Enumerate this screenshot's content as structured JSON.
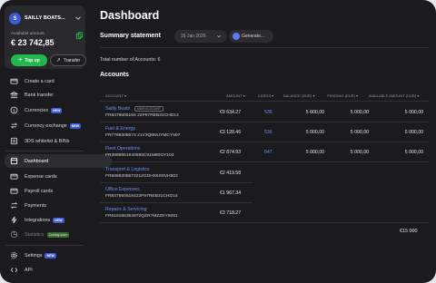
{
  "account": {
    "avatar_letter": "S",
    "name": "SAILLY BOATS...",
    "available_label": "Available amount",
    "available_amount": "€ 23 742,85",
    "topup_label": "Top up",
    "transfer_label": "Transfer"
  },
  "nav": {
    "create_card": "Create a card",
    "bank_transfer": "Bank transfer",
    "currencies": "Currencies",
    "currency_exchange": "Currency exchange",
    "whitelist": "3DS whitelist & BINs",
    "dashboard": "Dashboard",
    "expense_cards": "Expense cards",
    "payroll_cards": "Payroll cards",
    "payments": "Payments",
    "integrations": "Integrations",
    "statistics": "Statistics",
    "statistics_badge": "Coming soon",
    "settings": "Settings",
    "api": "API",
    "new_badge": "NEW"
  },
  "header": {
    "title": "Dashboard",
    "statement_label": "Summary statement",
    "date_value": "16 Jan 2026",
    "generate_label": "Generate..."
  },
  "summary": {
    "total_accounts": "Total number of Accounts: 6",
    "accounts_heading": "Accounts"
  },
  "table": {
    "headers": {
      "account": "ACCOUNT",
      "amount": "AMOUNT",
      "cards": "CARDS",
      "balance": "BALANCE (EUR)",
      "pending": "PENDING (EUR)",
      "available": "AVAILABLE AMOUNT (EUR)"
    },
    "main_badge": "MAIN ACCOUNT",
    "rows": [
      {
        "name": "Sailly Boats",
        "iban": "FR8479505184 22P97REB31CHD14",
        "amount": "€9 634.27",
        "cards": "536",
        "balance": "5 000,00",
        "pending": "5 000,00",
        "available": "5 000,00"
      },
      {
        "name": "Fuel & Energy",
        "iban": "FR7769308673 21V3Q9NUYMCY507",
        "amount": "€3 128.46",
        "cards": "536",
        "balance": "5 000,00",
        "pending": "5 000,00",
        "available": "5 000,00"
      },
      {
        "name": "Fleet Operations",
        "iban": "FR3889951940693C91M60GY104",
        "amount": "€2 874.93",
        "cards": "647",
        "balance": "5 000,00",
        "pending": "5 000,00",
        "available": "5 000,00"
      },
      {
        "name": "Transport & Logistics",
        "iban": "FR5869308673212GDHX5S9VH902",
        "amount": "€2 419.58",
        "cards": "",
        "balance": "",
        "pending": "",
        "available": ""
      },
      {
        "name": "Office Expenses",
        "iban": "FR847950518422P97REB31CHD14",
        "amount": "€1 967.34",
        "cards": "",
        "balance": "",
        "pending": "",
        "available": ""
      },
      {
        "name": "Repairs & Servicing",
        "iban": "FR616186354972QZR7MZZEY8091",
        "amount": "€3 718.27",
        "cards": "",
        "balance": "",
        "pending": "",
        "available": ""
      }
    ],
    "grand_total": "€15 000"
  },
  "colors": {
    "accent": "#3b5bd9",
    "link": "#6d8df5",
    "topup": "#22b84e",
    "background": "#1b1b1e"
  }
}
